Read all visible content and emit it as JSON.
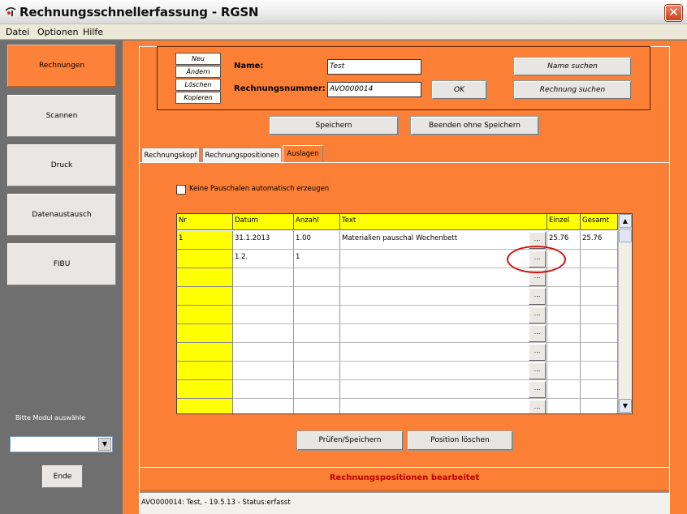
{
  "window": {
    "title": "Rechnungsschnellerfassung - RGSN",
    "close_glyph": "✕",
    "icon": "app-icon"
  },
  "menu": [
    {
      "label": "Datei"
    },
    {
      "label": "Optionen"
    },
    {
      "label": "Hilfe"
    }
  ],
  "nav": [
    {
      "label": "Rechnungen",
      "active": true
    },
    {
      "label": "Scannen"
    },
    {
      "label": "Druck"
    },
    {
      "label": "Datenaustausch"
    },
    {
      "label": "FIBU"
    }
  ],
  "module_prompt": "Bitte Modul auswähle",
  "module_select_value": "",
  "ende_label": "Ende",
  "header": {
    "neu": "Neu",
    "aendern": "Ändern",
    "loeschen": "Löschen",
    "kopieren": "Kopieren",
    "name_label": "Name:",
    "name_value": "Test",
    "nummer_label": "Rechnungsnummer:",
    "nummer_value": "AVO000014",
    "ok": "OK",
    "name_suchen": "Name suchen",
    "rechnung_suchen": "Rechnung suchen"
  },
  "actions": {
    "speichern": "Speichern",
    "beenden": "Beenden ohne Speichern"
  },
  "tabs": [
    {
      "label": "Rechnungskopf"
    },
    {
      "label": "Rechnungspositionen"
    },
    {
      "label": "Auslagen",
      "active": true
    }
  ],
  "checkbox": {
    "label": "Keine Pauschalen automatisch erzeugen",
    "checked": false
  },
  "grid": {
    "columns": [
      "Nr",
      "Datum",
      "Anzahl",
      "Text",
      "Einzel",
      "Gesamt"
    ],
    "rows": [
      {
        "nr": "1",
        "datum": "31.1.2013",
        "anzahl": "1.00",
        "text": "Materialien pauschal Wochenbett",
        "einzel": "25.76",
        "gesamt": "25.76"
      },
      {
        "nr": "",
        "datum": "1.2.",
        "anzahl": "1",
        "text": "",
        "einzel": "",
        "gesamt": ""
      },
      {
        "nr": "",
        "datum": "",
        "anzahl": "",
        "text": "",
        "einzel": "",
        "gesamt": ""
      },
      {
        "nr": "",
        "datum": "",
        "anzahl": "",
        "text": "",
        "einzel": "",
        "gesamt": ""
      },
      {
        "nr": "",
        "datum": "",
        "anzahl": "",
        "text": "",
        "einzel": "",
        "gesamt": ""
      },
      {
        "nr": "",
        "datum": "",
        "anzahl": "",
        "text": "",
        "einzel": "",
        "gesamt": ""
      },
      {
        "nr": "",
        "datum": "",
        "anzahl": "",
        "text": "",
        "einzel": "",
        "gesamt": ""
      },
      {
        "nr": "",
        "datum": "",
        "anzahl": "",
        "text": "",
        "einzel": "",
        "gesamt": ""
      },
      {
        "nr": "",
        "datum": "",
        "anzahl": "",
        "text": "",
        "einzel": "",
        "gesamt": ""
      },
      {
        "nr": "",
        "datum": "",
        "anzahl": "",
        "text": "",
        "einzel": "",
        "gesamt": ""
      }
    ],
    "ellipsis": "..."
  },
  "bottom_buttons": {
    "pruefen": "Prüfen/Speichern",
    "position_loeschen": "Position löschen"
  },
  "status_message": "Rechnungspositionen bearbeitet",
  "status_info": "AVO000014: Test,  - 19.5.13 - Status:erfasst",
  "colors": {
    "accent": "#fb7f34",
    "highlight": "#ffff00",
    "status_text": "#c00000",
    "annotation": "#d41010"
  }
}
